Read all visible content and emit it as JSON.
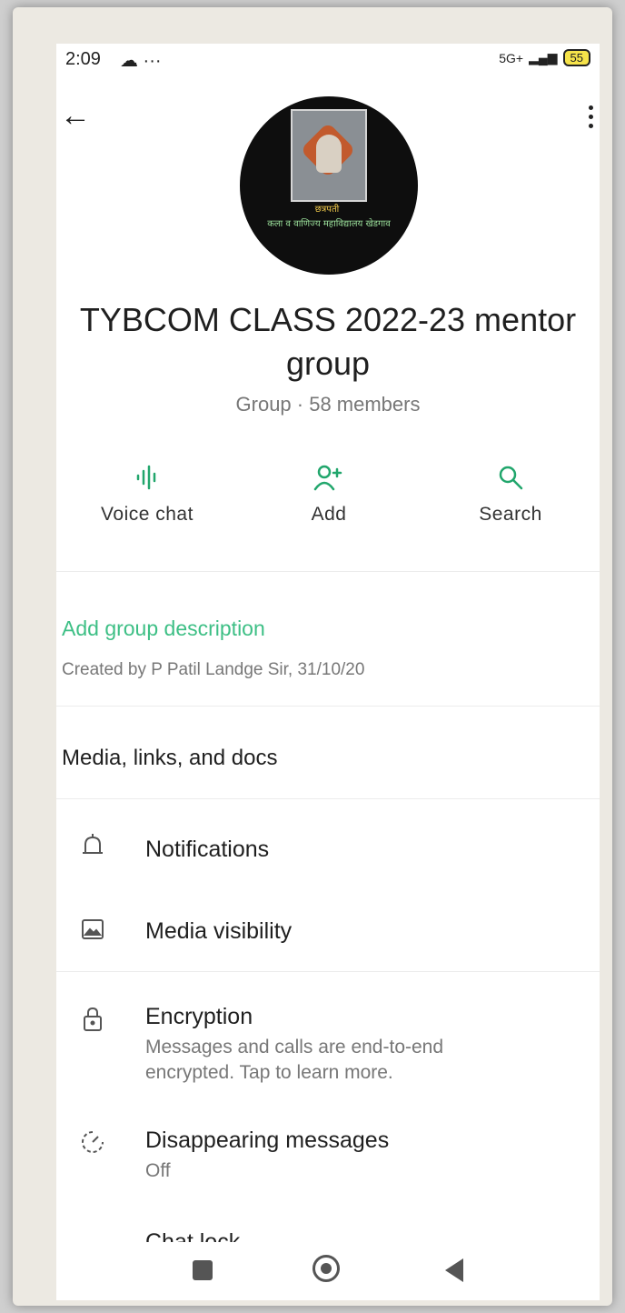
{
  "status_bar": {
    "time": "2:09",
    "left_icons": "☁ ···",
    "network": "5G+",
    "battery": "55"
  },
  "group": {
    "name": "TYBCOM CLASS 2022-23 mentor group",
    "meta": "Group · 58 members"
  },
  "actions": [
    {
      "label": "Voice chat",
      "icon": "voice-chat-icon"
    },
    {
      "label": "Add",
      "icon": "add-person-icon"
    },
    {
      "label": "Search",
      "icon": "search-icon"
    }
  ],
  "description": {
    "add_label": "Add group description",
    "created": "Created by P Patil Landge Sir, 31/10/20"
  },
  "media_links": "Media, links, and docs",
  "settings": [
    {
      "title": "Notifications",
      "icon": "bell-icon"
    },
    {
      "title": "Media visibility",
      "icon": "image-icon"
    },
    {
      "title": "Encryption",
      "sub": "Messages and calls are end-to-end encrypted. Tap to learn more.",
      "icon": "lock-icon"
    },
    {
      "title": "Disappearing messages",
      "sub": "Off",
      "icon": "timer-icon"
    },
    {
      "title": "Chat lock",
      "icon": "chat-lock-icon"
    }
  ],
  "avatar": {
    "name_text": "छत्रपती",
    "caption": "कला व वाणिज्य महाविद्यालय खेडगाव"
  }
}
